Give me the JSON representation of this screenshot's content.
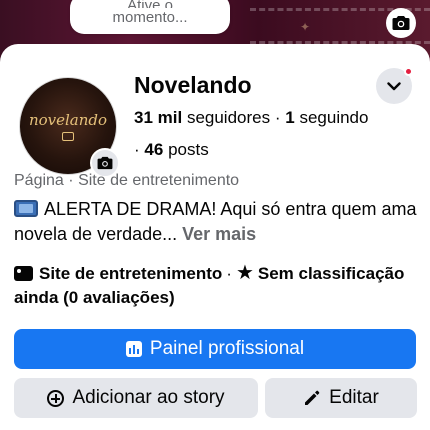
{
  "bubble": {
    "line1": "Ative o",
    "line2": "momento..."
  },
  "profile": {
    "name": "Novelando",
    "logo_text": "novelando",
    "followers_count": "31 mil",
    "followers_label": "seguidores",
    "following_count": "1",
    "following_label": "seguindo",
    "posts_count": "46",
    "posts_label": "posts",
    "page_type": "Página",
    "category": "Site de entretenimento",
    "bio": "ALERTA DE DRAMA! Aqui só entra quem ama novela de verdade...",
    "see_more": "Ver mais",
    "meta_category": "Site de entretenimento",
    "rating": "Sem classificação ainda (0 avaliações)"
  },
  "buttons": {
    "professional": "Painel profissional",
    "add_story": "Adicionar ao story",
    "edit": "Editar"
  },
  "icons": {
    "cover_camera": "camera-icon",
    "avatar_camera": "camera-icon",
    "menu": "chevron-down-icon",
    "notification_dot": "red-dot",
    "bio_emoji": "tv-icon",
    "category": "page-icon",
    "rating": "star-icon",
    "professional": "bar-chart-icon",
    "story": "plus-circle-icon",
    "edit": "pencil-icon"
  },
  "colors": {
    "primary": "#1877f2",
    "secondary_button": "#e4e6eb",
    "muted_text": "#65676b",
    "notification": "#e41e3f"
  }
}
